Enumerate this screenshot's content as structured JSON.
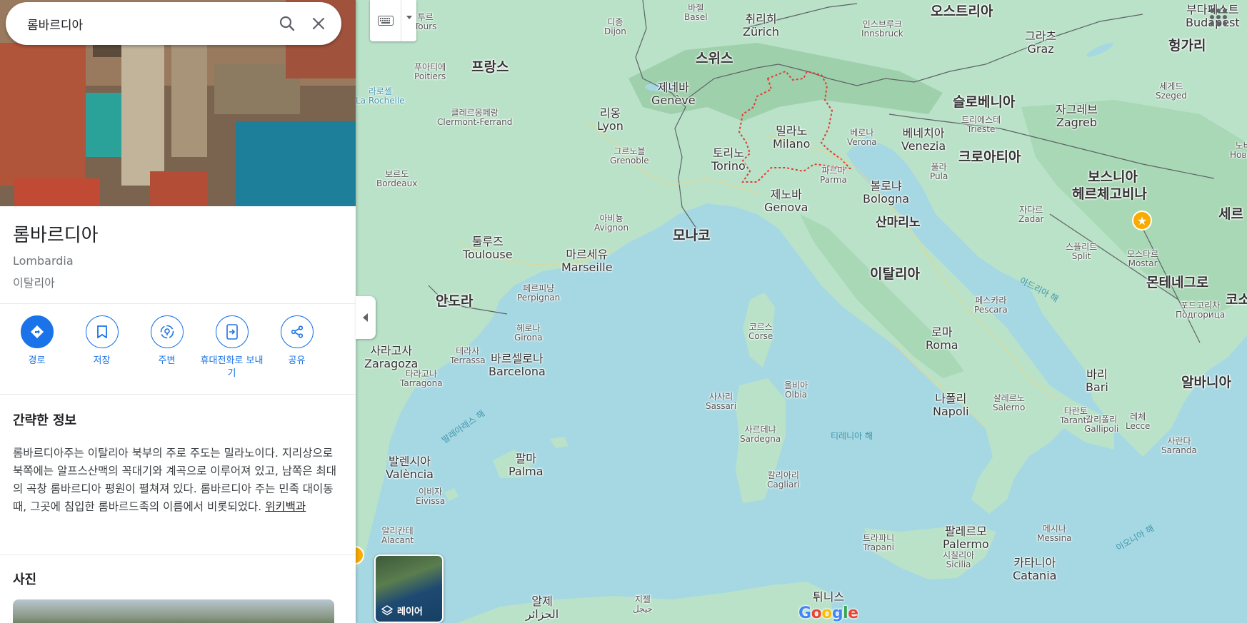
{
  "search": {
    "value": "롬바르디아"
  },
  "place": {
    "title": "롬바르디아",
    "subtitle": "Lombardia",
    "country": "이탈리아"
  },
  "actions": [
    {
      "label": "경로",
      "icon": "directions-icon"
    },
    {
      "label": "저장",
      "icon": "bookmark-icon"
    },
    {
      "label": "주변",
      "icon": "nearby-icon"
    },
    {
      "label": "휴대전화로 보내기",
      "icon": "send-to-phone-icon"
    },
    {
      "label": "공유",
      "icon": "share-icon"
    }
  ],
  "about": {
    "heading": "간략한 정보",
    "text": "롬바르디아주는 이탈리아 북부의 주로 주도는 밀라노이다. 지리상으로 북쪽에는 알프스산맥의 꼭대기와 계곡으로 이루어져 있고, 남쪽은 최대의 곡창 롬바르디아 평원이 펼쳐져 있다. 롬바르디아 주는 민족 대이동 때, 그곳에 침입한 롬바르드족의 이름에서 비롯되었다.",
    "link": "위키백과"
  },
  "photos": {
    "heading": "사진"
  },
  "layers": {
    "label": "레이어"
  },
  "google": "Google",
  "colors": {
    "accent": "#1a73e8",
    "sea": "#a6d8e3",
    "land": "#b9e2c8",
    "region_outline": "#e53935"
  },
  "map_labels": {
    "countries": {
      "france": "프랑스",
      "switzerland": "스위스",
      "austria": "오스트리아",
      "hungary": "헝가리",
      "slovenia": "슬로베니아",
      "croatia": "크로아티아",
      "bosnia1": "보스니아",
      "bosnia2": "헤르체고비나",
      "serbia": "세르",
      "montenegro": "몬테네그로",
      "kosovo": "코소",
      "albania": "알바니아",
      "italy": "이탈리아",
      "monaco": "모나코",
      "sanmarino": "산마리노",
      "andorra": "안도라"
    },
    "cities": {
      "tours": [
        "투르",
        "Tours"
      ],
      "basel": [
        "바젤",
        "Basel"
      ],
      "zurich": [
        "취리히",
        "Zürich"
      ],
      "dijon": [
        "디종",
        "Dijon"
      ],
      "innsbruck": [
        "인스브루크",
        "Innsbruck"
      ],
      "graz": [
        "그라츠",
        "Graz"
      ],
      "budapest": [
        "부다페스트",
        "Budapest"
      ],
      "poitiers": [
        "푸아티에",
        "Poitiers"
      ],
      "larochelle": [
        "라로셸",
        "La Rochelle"
      ],
      "geneve": [
        "제네바",
        "Genève"
      ],
      "lyon": [
        "리옹",
        "Lyon"
      ],
      "clermont": [
        "클레르몽페랑",
        "Clermont-Ferrand"
      ],
      "milano": [
        "밀라노",
        "Milano"
      ],
      "verona": [
        "베로나",
        "Verona"
      ],
      "venezia": [
        "베네치아",
        "Venezia"
      ],
      "trieste": [
        "트리에스테",
        "Trieste"
      ],
      "zagreb": [
        "자그레브",
        "Zagreb"
      ],
      "szeged": [
        "세게드",
        "Szeged"
      ],
      "grenoble": [
        "그르노블",
        "Grenoble"
      ],
      "torino": [
        "토리노",
        "Torino"
      ],
      "parma": [
        "파르마",
        "Parma"
      ],
      "bologna": [
        "볼로냐",
        "Bologna"
      ],
      "pula": [
        "풀라",
        "Pula"
      ],
      "novisad": [
        "노비사드",
        "Нови Сад"
      ],
      "bordeaux": [
        "보르도",
        "Bordeaux"
      ],
      "genova": [
        "제노바",
        "Genova"
      ],
      "avignon": [
        "아비뇽",
        "Avignon"
      ],
      "zadar": [
        "자다르",
        "Zadar"
      ],
      "toulouse": [
        "툴루즈",
        "Toulouse"
      ],
      "marseille": [
        "마르세유",
        "Marseille"
      ],
      "split": [
        "스플리트",
        "Split"
      ],
      "mostar": [
        "모스타르",
        "Mostar"
      ],
      "perpignan": [
        "페르피냥",
        "Perpignan"
      ],
      "pescara": [
        "페스카라",
        "Pescara"
      ],
      "podgorica": [
        "포드고리차",
        "Подгорица"
      ],
      "corse": [
        "코르스",
        "Corse"
      ],
      "girona": [
        "헤로나",
        "Girona"
      ],
      "roma": [
        "로마",
        "Roma"
      ],
      "zaragoza": [
        "사라고사",
        "Zaragoza"
      ],
      "terrassa": [
        "테라사",
        "Terrassa"
      ],
      "barcelona": [
        "바르셀로나",
        "Barcelona"
      ],
      "tarragona": [
        "타라고나",
        "Tarragona"
      ],
      "bari": [
        "바리",
        "Bari"
      ],
      "olbia": [
        "올비아",
        "Olbia"
      ],
      "sassari": [
        "사사리",
        "Sassari"
      ],
      "napoli": [
        "나폴리",
        "Napoli"
      ],
      "salerno": [
        "살레르노",
        "Salerno"
      ],
      "taranto": [
        "타란토",
        "Taranto"
      ],
      "lecce": [
        "레체",
        "Lecce"
      ],
      "gallipoli": [
        "갈리폴리",
        "Gallipoli"
      ],
      "sardegna": [
        "사르데냐",
        "Sardegna"
      ],
      "saranda": [
        "사란다",
        "Saranda"
      ],
      "valencia": [
        "발렌시아",
        "València"
      ],
      "palma": [
        "팔마",
        "Palma"
      ],
      "eivissa": [
        "이비자",
        "Eivissa"
      ],
      "cagliari": [
        "칼리아리",
        "Cagliari"
      ],
      "alacant": [
        "알리칸테",
        "Alacant"
      ],
      "palermo": [
        "팔레르모",
        "Palermo"
      ],
      "sicilia": [
        "시칠리아",
        "Sicilia"
      ],
      "trapani": [
        "트라파니",
        "Trapani"
      ],
      "messina": [
        "메시나",
        "Messina"
      ],
      "catania": [
        "카타니아",
        "Catania"
      ],
      "alger": [
        "알제",
        "الجزائر"
      ],
      "tunis": [
        "튀니스",
        ""
      ],
      "jijel": [
        "지젤",
        "جيجل"
      ]
    },
    "seas": {
      "adriatic": "아드리아 해",
      "tyrrhenian": "티레니아 해",
      "balearic": "발레아레스 해",
      "ionian": "이오니아 해"
    }
  }
}
